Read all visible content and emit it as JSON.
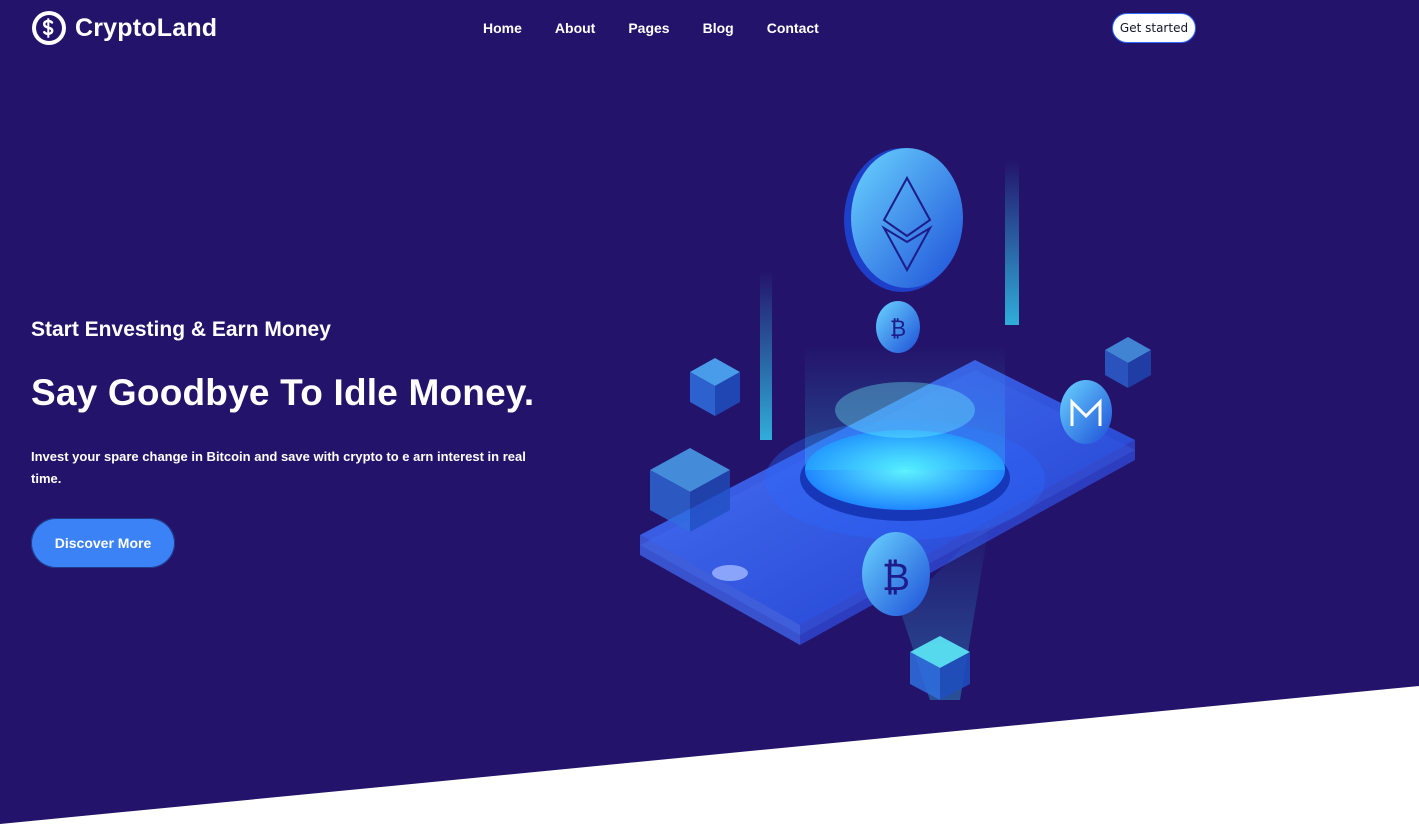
{
  "brand": {
    "name": "CryptoLand",
    "logo_icon": "dollar-coin-icon"
  },
  "nav": {
    "items": [
      "Home",
      "About",
      "Pages",
      "Blog",
      "Contact"
    ],
    "cta": "Get started"
  },
  "hero": {
    "eyebrow": "Start Envesting & Earn Money",
    "title": "Say Goodbye To Idle Money.",
    "description": "Invest your spare change in Bitcoin and save with crypto to e arn interest in real time.",
    "button": "Discover More"
  },
  "colors": {
    "background": "#23136b",
    "accent": "#3b82f6",
    "white": "#ffffff"
  }
}
